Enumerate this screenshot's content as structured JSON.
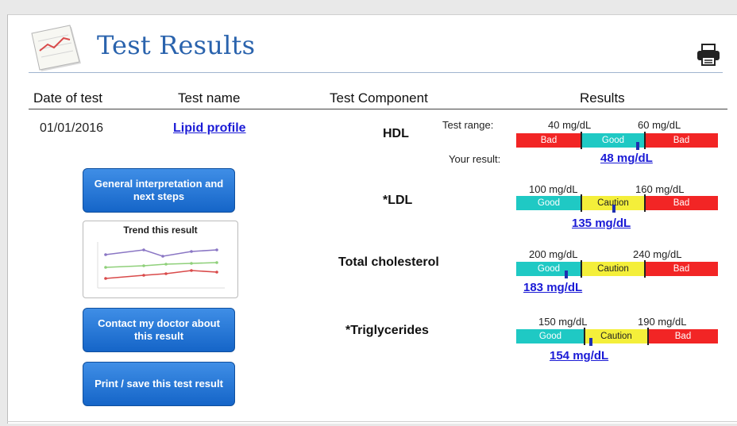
{
  "header": {
    "title": "Test Results",
    "icon": "document-chart-icon",
    "print_icon": "printer-icon"
  },
  "columns": {
    "date": "Date of test",
    "name": "Test name",
    "component": "Test Component",
    "results": "Results"
  },
  "test": {
    "date": "01/01/2016",
    "name": "Lipid profile"
  },
  "labels": {
    "test_range": "Test range:",
    "your_result": "Your result:"
  },
  "buttons": {
    "interpretation": "General interpretation and next steps",
    "trend": "Trend this result",
    "contact": "Contact my doctor about this result",
    "print_save": "Print / save this test result"
  },
  "components": [
    {
      "name": "HDL",
      "threshold_low": "40 mg/dL",
      "threshold_high": "60 mg/dL",
      "segments": [
        "Bad",
        "Good",
        "Bad"
      ],
      "result": "48 mg/dL"
    },
    {
      "name": "*LDL",
      "threshold_low": "100 mg/dL",
      "threshold_high": "160 mg/dL",
      "segments": [
        "Good",
        "Caution",
        "Bad"
      ],
      "result": "135 mg/dL"
    },
    {
      "name": "Total cholesterol",
      "threshold_low": "200 mg/dL",
      "threshold_high": "240 mg/dL",
      "segments": [
        "Good",
        "Caution",
        "Bad"
      ],
      "result": "183 mg/dL"
    },
    {
      "name": "*Triglycerides",
      "threshold_low": "150 mg/dL",
      "threshold_high": "190 mg/dL",
      "segments": [
        "Good",
        "Caution",
        "Bad"
      ],
      "result": "154 mg/dL"
    }
  ],
  "colors": {
    "title": "#2a63ad",
    "link": "#1b1bd6",
    "bad": "#f22525",
    "good": "#1fc9c4",
    "caution": "#f4ef3a",
    "button": "#1565c8"
  }
}
